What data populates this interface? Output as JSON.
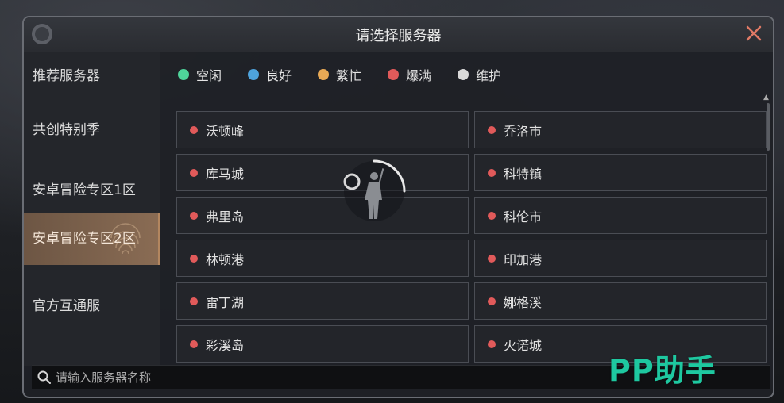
{
  "dialog": {
    "title": "请选择服务器"
  },
  "sidebar": {
    "items": [
      {
        "label": "推荐服务器",
        "active": false
      },
      {
        "label": "共创特别季",
        "active": false
      },
      {
        "label": "安卓冒险专区1区",
        "active": false
      },
      {
        "label": "安卓冒险专区2区",
        "active": true
      },
      {
        "label": "官方互通服",
        "active": false
      }
    ]
  },
  "legend": [
    {
      "label": "空闲",
      "color": "#4fd39a"
    },
    {
      "label": "良好",
      "color": "#4ea3dc"
    },
    {
      "label": "繁忙",
      "color": "#e8a955"
    },
    {
      "label": "爆满",
      "color": "#e15a5a"
    },
    {
      "label": "维护",
      "color": "#d9d9d9"
    }
  ],
  "servers": [
    {
      "name": "沃顿峰",
      "color": "#e15a5a"
    },
    {
      "name": "乔洛市",
      "color": "#e15a5a"
    },
    {
      "name": "库马城",
      "color": "#e15a5a"
    },
    {
      "name": "科特镇",
      "color": "#e15a5a"
    },
    {
      "name": "弗里岛",
      "color": "#e15a5a"
    },
    {
      "name": "科伦市",
      "color": "#e15a5a"
    },
    {
      "name": "林顿港",
      "color": "#e15a5a"
    },
    {
      "name": "印加港",
      "color": "#e15a5a"
    },
    {
      "name": "雷丁湖",
      "color": "#e15a5a"
    },
    {
      "name": "娜格溪",
      "color": "#e15a5a"
    },
    {
      "name": "彩溪岛",
      "color": "#e15a5a"
    },
    {
      "name": "火诺城",
      "color": "#e15a5a"
    }
  ],
  "search": {
    "placeholder": "请输入服务器名称",
    "value": ""
  },
  "watermark": {
    "text": "PP助手"
  }
}
